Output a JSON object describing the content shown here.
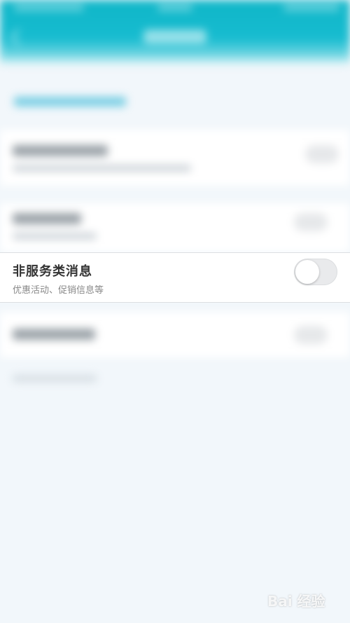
{
  "notification_row": {
    "title": "非服务类消息",
    "subtitle": "优惠活动、促销信息等",
    "toggle_state": "off"
  },
  "watermark": {
    "text": "Bai 经验"
  },
  "colors": {
    "header": "#17bcd0",
    "background": "#f2f7fb",
    "toggle_off": "#e9eaec"
  }
}
